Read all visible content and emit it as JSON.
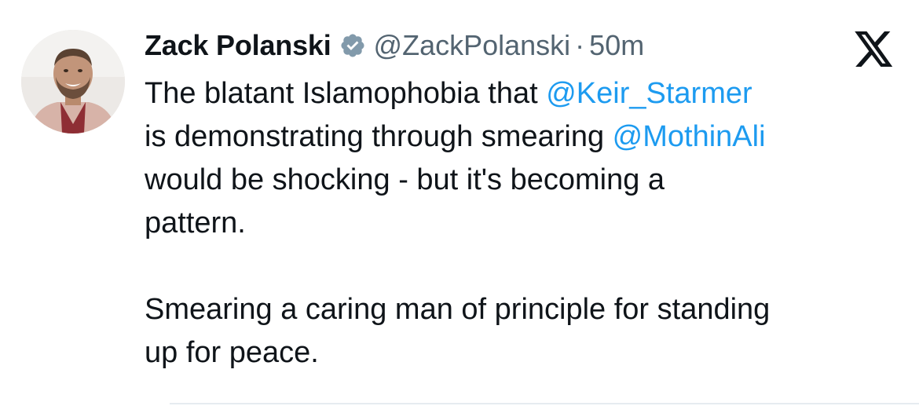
{
  "tweet": {
    "author": {
      "name": "Zack Polanski",
      "handle": "@ZackPolanski",
      "verified_icon": "verified-badge-icon",
      "avatar": "profile-photo"
    },
    "separator": "·",
    "time": "50m",
    "platform_icon": "x-logo-icon",
    "text": {
      "p1_l1_a": "The blatant Islamophobia that ",
      "p1_l1_mention": "@Keir_Starmer",
      "p1_l2_a": "is demonstrating through smearing ",
      "p1_l2_mention": "@MothinAli",
      "p1_l3": "would be shocking - but it's becoming a",
      "p1_l4": "pattern.",
      "p2_l1": "Smearing a caring man of principle for standing",
      "p2_l2": "up for peace."
    }
  },
  "colors": {
    "text": "#0f1419",
    "secondary": "#536471",
    "link": "#1d9bf0",
    "verified": "#829aab"
  }
}
